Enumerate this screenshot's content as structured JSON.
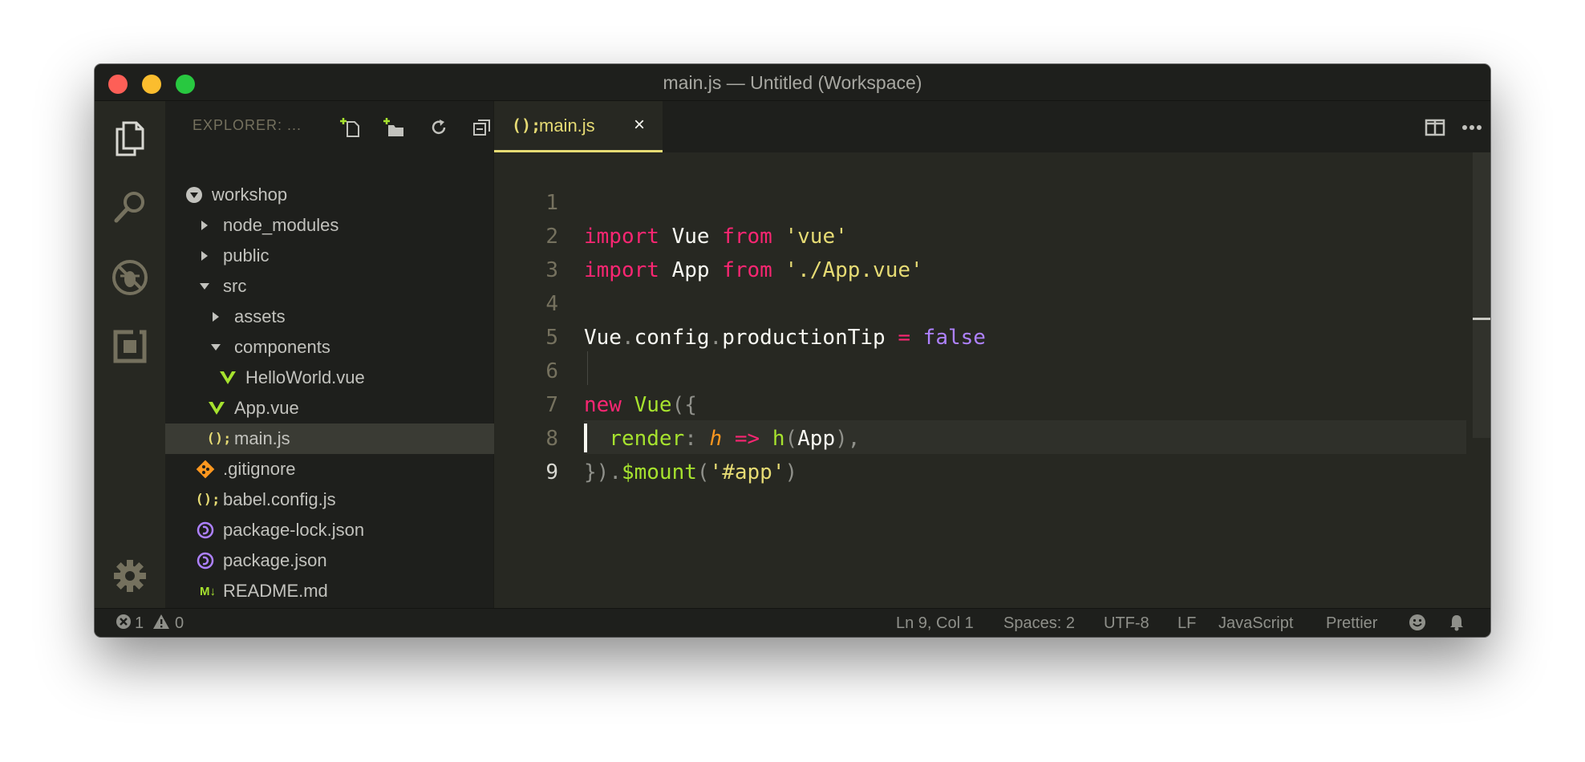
{
  "window": {
    "title": "main.js — Untitled (Workspace)"
  },
  "colors": {
    "background": "#272822",
    "sidebar": "#1e1f1c",
    "keyword": "#f92672",
    "string": "#e6db74",
    "function": "#a6e22e",
    "constant": "#ae81ff",
    "parameter": "#fd971f",
    "vue_icon": "#a6e22e",
    "json_icon": "#ae81ff",
    "git_icon": "#fd971f"
  },
  "activity_bar": {
    "items": [
      {
        "icon": "files-icon"
      },
      {
        "icon": "search-icon"
      },
      {
        "icon": "debug-icon"
      },
      {
        "icon": "extensions-icon"
      },
      {
        "icon": "gear-icon"
      }
    ]
  },
  "sidebar": {
    "title": "EXPLORER: ...",
    "actions": [
      "new-file-icon",
      "new-folder-icon",
      "refresh-icon",
      "collapse-all-icon"
    ],
    "tree": [
      {
        "label": "workshop",
        "type": "root"
      },
      {
        "label": "node_modules",
        "type": "folder"
      },
      {
        "label": "public",
        "type": "folder"
      },
      {
        "label": "src",
        "type": "folder"
      },
      {
        "label": "assets",
        "type": "folder"
      },
      {
        "label": "components",
        "type": "folder"
      },
      {
        "label": "HelloWorld.vue",
        "type": "vue"
      },
      {
        "label": "App.vue",
        "type": "vue"
      },
      {
        "label": "main.js",
        "type": "js",
        "icon_text": "();"
      },
      {
        "label": ".gitignore",
        "type": "git"
      },
      {
        "label": "babel.config.js",
        "type": "js",
        "icon_text": "();"
      },
      {
        "label": "package-lock.json",
        "type": "json"
      },
      {
        "label": "package.json",
        "type": "json"
      },
      {
        "label": "README.md",
        "type": "md",
        "icon_text": "M↓"
      }
    ]
  },
  "editor": {
    "tab": {
      "label": "main.js",
      "icon_text": "();",
      "close": "×"
    },
    "actions": [
      "split-editor-icon",
      "more-icon"
    ],
    "line_numbers": [
      "1",
      "2",
      "3",
      "4",
      "5",
      "6",
      "7",
      "8",
      "9"
    ],
    "lines": [
      [
        "import",
        " ",
        "Vue",
        " ",
        "from",
        " ",
        "'vue'"
      ],
      [
        "import",
        " ",
        "App",
        " ",
        "from",
        " ",
        "'./App.vue'"
      ],
      [],
      [
        "Vue",
        ".",
        "config",
        ".",
        "productionTip",
        " ",
        "=",
        " ",
        "false"
      ],
      [],
      [
        "new",
        " ",
        "Vue",
        "({"
      ],
      [
        "  ",
        "render",
        ":",
        " ",
        "h",
        " ",
        "=>",
        " ",
        "h",
        "(",
        "App",
        "),"
      ],
      [
        "})",
        ".",
        "$mount",
        "(",
        "'#app'",
        ")"
      ],
      []
    ]
  },
  "status": {
    "errors": "1",
    "warnings": "0",
    "position": "Ln 9, Col 1",
    "spaces": "Spaces: 2",
    "encoding": "UTF-8",
    "eol": "LF",
    "language": "JavaScript",
    "formatter": "Prettier"
  }
}
